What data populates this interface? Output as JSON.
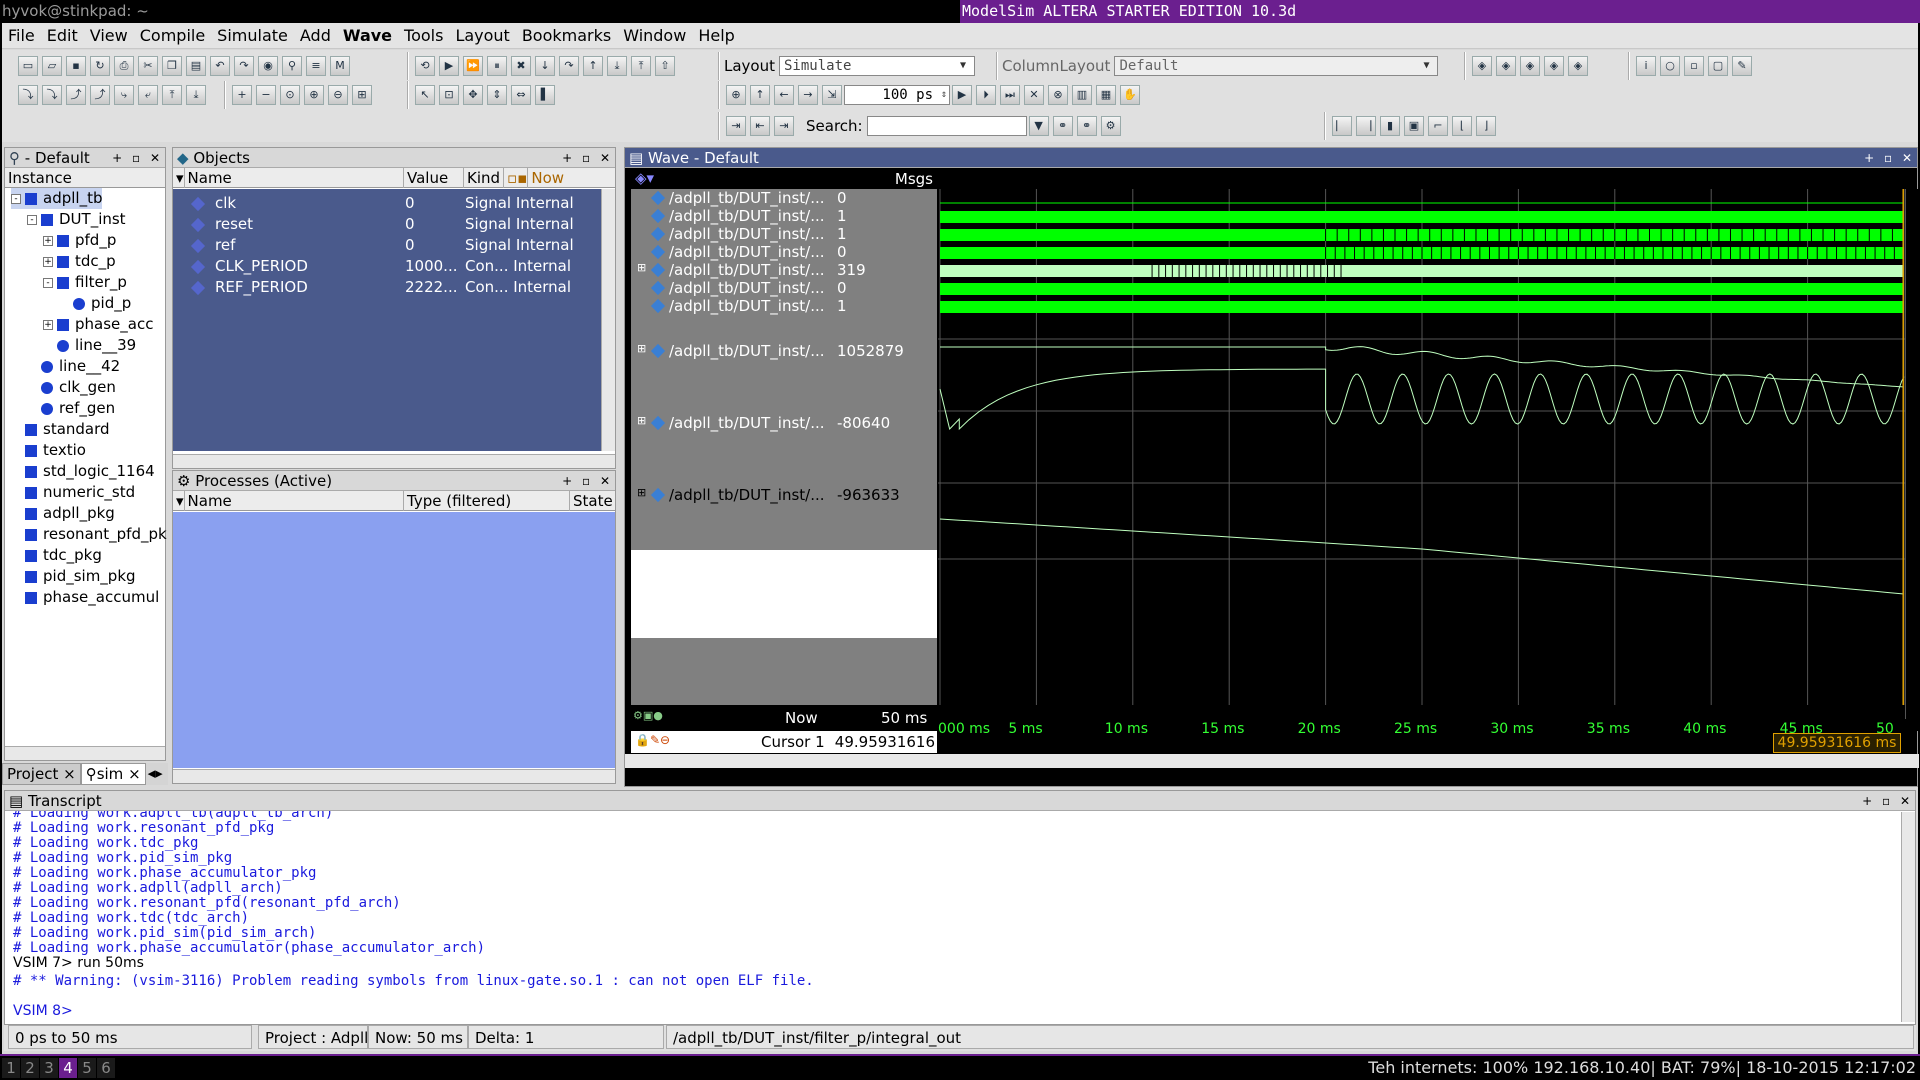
{
  "wm": {
    "left_title": "hyvok@stinkpad: ~",
    "window_title": "ModelSim ALTERA STARTER EDITION 10.3d"
  },
  "menu": [
    "File",
    "Edit",
    "View",
    "Compile",
    "Simulate",
    "Add",
    "Wave",
    "Tools",
    "Layout",
    "Bookmarks",
    "Window",
    "Help"
  ],
  "toolbar": {
    "layout_label": "Layout",
    "layout_value": "Simulate",
    "columnlayout_label": "ColumnLayout",
    "columnlayout_value": "Default",
    "runtime_value": "100 ps",
    "search_label": "Search:",
    "search_placeholder": ""
  },
  "instance_pane": {
    "title": "- Default",
    "col": "Instance",
    "rows": [
      {
        "label": "adpll_tb",
        "indent": 0,
        "exp": "-",
        "icon": "sq"
      },
      {
        "label": "DUT_inst",
        "indent": 1,
        "exp": "-",
        "icon": "sq"
      },
      {
        "label": "pfd_p",
        "indent": 2,
        "exp": "+",
        "icon": "sq"
      },
      {
        "label": "tdc_p",
        "indent": 2,
        "exp": "+",
        "icon": "sq"
      },
      {
        "label": "filter_p",
        "indent": 2,
        "exp": "-",
        "icon": "sq"
      },
      {
        "label": "pid_p",
        "indent": 3,
        "exp": "",
        "icon": "dot"
      },
      {
        "label": "phase_acc",
        "indent": 2,
        "exp": "+",
        "icon": "sq"
      },
      {
        "label": "line__39",
        "indent": 2,
        "exp": "",
        "icon": "dot"
      },
      {
        "label": "line__42",
        "indent": 1,
        "exp": "",
        "icon": "dot"
      },
      {
        "label": "clk_gen",
        "indent": 1,
        "exp": "",
        "icon": "dot"
      },
      {
        "label": "ref_gen",
        "indent": 1,
        "exp": "",
        "icon": "dot"
      },
      {
        "label": "standard",
        "indent": 0,
        "exp": "",
        "icon": "sq"
      },
      {
        "label": "textio",
        "indent": 0,
        "exp": "",
        "icon": "sq"
      },
      {
        "label": "std_logic_1164",
        "indent": 0,
        "exp": "",
        "icon": "sq"
      },
      {
        "label": "numeric_std",
        "indent": 0,
        "exp": "",
        "icon": "sq"
      },
      {
        "label": "adpll_pkg",
        "indent": 0,
        "exp": "",
        "icon": "sq"
      },
      {
        "label": "resonant_pfd_pk",
        "indent": 0,
        "exp": "",
        "icon": "sq"
      },
      {
        "label": "tdc_pkg",
        "indent": 0,
        "exp": "",
        "icon": "sq"
      },
      {
        "label": "pid_sim_pkg",
        "indent": 0,
        "exp": "",
        "icon": "sq"
      },
      {
        "label": "phase_accumul",
        "indent": 0,
        "exp": "",
        "icon": "sq"
      }
    ],
    "tabs": [
      "Project",
      "sim"
    ]
  },
  "objects_pane": {
    "title": "Objects",
    "cols": [
      "Name",
      "Value",
      "Kind",
      "Now"
    ],
    "rows": [
      {
        "name": "clk",
        "value": "0",
        "kind": "Signal Internal"
      },
      {
        "name": "reset",
        "value": "0",
        "kind": "Signal Internal"
      },
      {
        "name": "ref",
        "value": "0",
        "kind": "Signal Internal"
      },
      {
        "name": "CLK_PERIOD",
        "value": "1000...",
        "kind": "Con... Internal"
      },
      {
        "name": "REF_PERIOD",
        "value": "2222...",
        "kind": "Con... Internal"
      }
    ]
  },
  "processes_pane": {
    "title": "Processes (Active)",
    "cols": [
      "Name",
      "Type (filtered)",
      "State"
    ]
  },
  "wave_pane": {
    "title": "Wave - Default",
    "msgs_header": "Msgs",
    "signals": [
      {
        "name": "/adpll_tb/DUT_inst/...",
        "value": "0",
        "exp": ""
      },
      {
        "name": "/adpll_tb/DUT_inst/...",
        "value": "1",
        "exp": ""
      },
      {
        "name": "/adpll_tb/DUT_inst/...",
        "value": "1",
        "exp": ""
      },
      {
        "name": "/adpll_tb/DUT_inst/...",
        "value": "0",
        "exp": ""
      },
      {
        "name": "/adpll_tb/DUT_inst/...",
        "value": "319",
        "exp": "+"
      },
      {
        "name": "/adpll_tb/DUT_inst/...",
        "value": "0",
        "exp": ""
      },
      {
        "name": "/adpll_tb/DUT_inst/...",
        "value": "1",
        "exp": ""
      },
      {
        "name": "/adpll_tb/DUT_inst/...",
        "value": "1052879",
        "exp": "+"
      },
      {
        "name": "/adpll_tb/DUT_inst/...",
        "value": "-80640",
        "exp": "+"
      },
      {
        "name": "/adpll_tb/DUT_inst/...",
        "value": "-963633",
        "exp": "+"
      }
    ],
    "now_label": "Now",
    "now_value": "50 ms",
    "cursor_label": "Cursor 1",
    "cursor_value": "49.95931616 ms",
    "cursor_box": "49.95931616 ms",
    "ticks": [
      "000 ms",
      "5 ms",
      "10 ms",
      "15 ms",
      "20 ms",
      "25 ms",
      "30 ms",
      "35 ms",
      "40 ms",
      "45 ms",
      "50"
    ]
  },
  "transcript": {
    "title": "Transcript",
    "lines": [
      "# Loading work.adpll_tb(adpll_tb_arch)",
      "# Loading work.resonant_pfd_pkg",
      "# Loading work.tdc_pkg",
      "# Loading work.pid_sim_pkg",
      "# Loading work.phase_accumulator_pkg",
      "# Loading work.adpll(adpll_arch)",
      "# Loading work.resonant_pfd(resonant_pfd_arch)",
      "# Loading work.tdc(tdc_arch)",
      "# Loading work.pid_sim(pid_sim_arch)",
      "# Loading work.phase_accumulator(phase_accumulator_arch)"
    ],
    "prompt1": "VSIM 7> run 50ms",
    "warning": "# ** Warning: (vsim-3116) Problem reading symbols from linux-gate.so.1 : can not open ELF file.",
    "prompt2": "VSIM 8>"
  },
  "statusbar": {
    "range": "0 ps to 50 ms",
    "project": "Project : Adpll",
    "now": "Now: 50 ms",
    "delta": "Delta: 1",
    "path": "/adpll_tb/DUT_inst/filter_p/integral_out"
  },
  "bottombar": {
    "workspaces": [
      "1",
      "2",
      "3",
      "4",
      "5",
      "6"
    ],
    "active": "4",
    "sysinfo": "Teh internets: 100% 192.168.10.40| BAT: 79%| 18-10-2015 12:17:02"
  },
  "colors": {
    "wave_green": "#00ff00",
    "analog": "#bfffbf",
    "panel_blue": "#4a5a8c",
    "process_blue": "#8aa0f0",
    "transcript_blue": "#1a1add",
    "accent_purple": "#6b1f8f"
  }
}
